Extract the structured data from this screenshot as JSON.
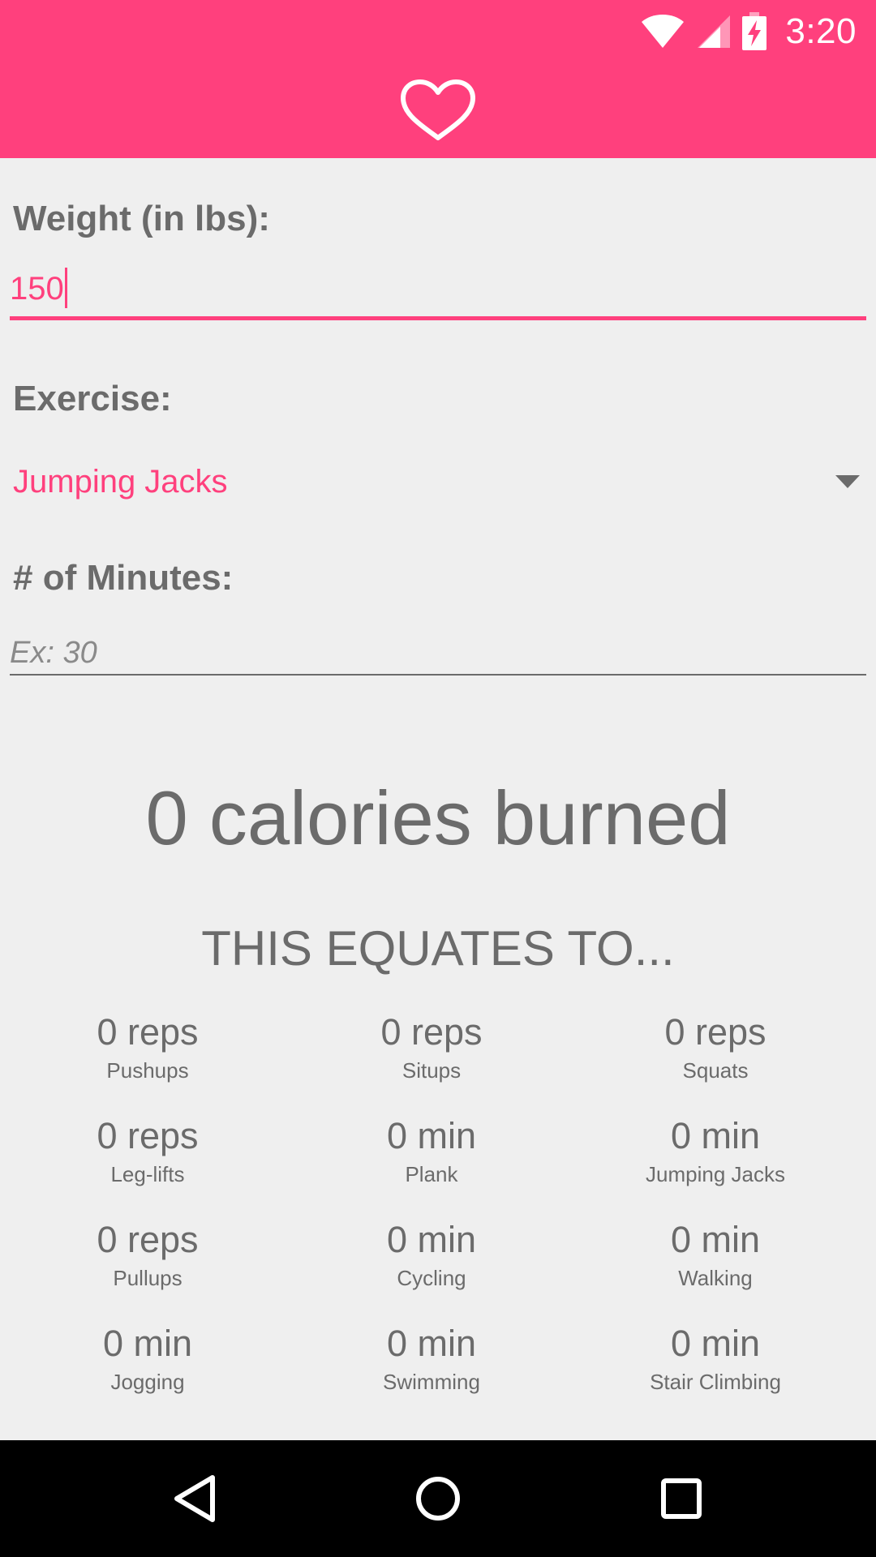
{
  "status_bar": {
    "time": "3:20",
    "icons": [
      "wifi-icon",
      "signal-icon",
      "battery-charging-icon"
    ]
  },
  "header": {
    "logo_icon": "heart-icon",
    "color": "#ff407d"
  },
  "form": {
    "weight_label": "Weight (in lbs):",
    "weight_value": "150",
    "exercise_label": "Exercise:",
    "exercise_selected": "Jumping Jacks",
    "minutes_label": "# of Minutes:",
    "minutes_placeholder": "Ex: 30",
    "minutes_value": ""
  },
  "result": {
    "calories_text": "0 calories burned",
    "equates_heading": "THIS EQUATES TO..."
  },
  "equivalents": [
    {
      "amount": "0 reps",
      "name": "Pushups"
    },
    {
      "amount": "0 reps",
      "name": "Situps"
    },
    {
      "amount": "0 reps",
      "name": "Squats"
    },
    {
      "amount": "0 reps",
      "name": "Leg-lifts"
    },
    {
      "amount": "0 min",
      "name": "Plank"
    },
    {
      "amount": "0 min",
      "name": "Jumping Jacks"
    },
    {
      "amount": "0 reps",
      "name": "Pullups"
    },
    {
      "amount": "0 min",
      "name": "Cycling"
    },
    {
      "amount": "0 min",
      "name": "Walking"
    },
    {
      "amount": "0 min",
      "name": "Jogging"
    },
    {
      "amount": "0 min",
      "name": "Swimming"
    },
    {
      "amount": "0 min",
      "name": "Stair Climbing"
    }
  ],
  "nav": {
    "icons": [
      "back-icon",
      "home-icon",
      "recents-icon"
    ]
  },
  "colors": {
    "accent": "#ff407d",
    "text": "#6b6b6b",
    "background": "#efefef"
  }
}
